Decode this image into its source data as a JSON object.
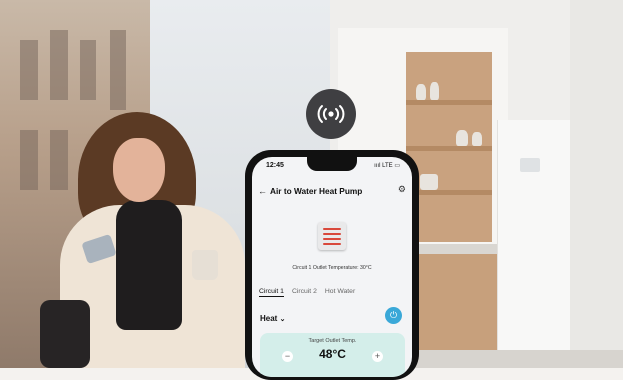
{
  "phone": {
    "status_time": "12:45",
    "status_icons": "ıııl LTE ▭",
    "title": "Air to Water Heat Pump",
    "outlet_temperature_label": "Circuit 1 Outlet Temperature: 30°C",
    "tabs": [
      {
        "label": "Circuit 1",
        "active": true
      },
      {
        "label": "Circuit 2",
        "active": false
      },
      {
        "label": "Hot Water",
        "active": false
      }
    ],
    "mode": "Heat",
    "mode_chevron": "⌄",
    "target": {
      "label": "Target Outlet Temp.",
      "value": "48°C",
      "minus": "−",
      "plus": "+"
    }
  },
  "icons": {
    "back": "←",
    "settings": "⚙",
    "power": "⏻",
    "wifi": "((•))"
  },
  "colors": {
    "accent": "#3aa8d8",
    "card": "#d4eeea",
    "wifi_badge": "#3f3f42",
    "heater_stripe": "#d9483b"
  }
}
